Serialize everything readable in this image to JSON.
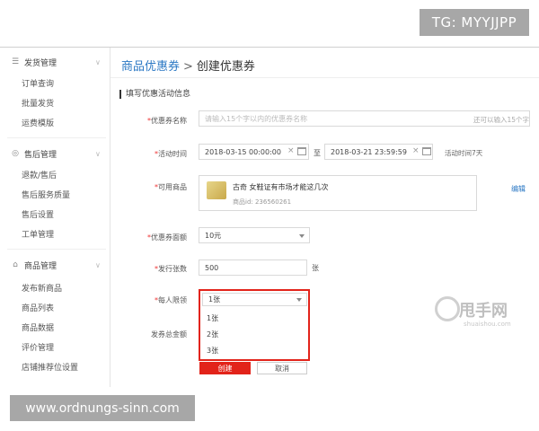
{
  "watermark_top": "TG: MYYJJPP",
  "watermark_bottom": "www.ordnungs-sinn.com",
  "site_watermark": {
    "logo": "甩手网",
    "sub": "shuaishou.com"
  },
  "sidebar": {
    "groups": [
      {
        "title": "发货管理",
        "icon": "list-icon",
        "items": [
          "订单查询",
          "批量发货",
          "运费模版"
        ]
      },
      {
        "title": "售后管理",
        "icon": "shield-icon",
        "items": [
          "退款/售后",
          "售后服务质量",
          "售后设置",
          "工单管理"
        ]
      },
      {
        "title": "商品管理",
        "icon": "bag-icon",
        "items": [
          "发布新商品",
          "商品列表",
          "商品数据",
          "评价管理",
          "店铺推荐位设置"
        ]
      }
    ]
  },
  "breadcrumb": {
    "parent": "商品优惠券",
    "separator": ">",
    "current": "创建优惠券"
  },
  "section_title": "填写优惠活动信息",
  "form": {
    "name": {
      "label": "优惠券名称",
      "placeholder": "请输入15个字以内的优惠券名称",
      "note": "还可以输入15个字"
    },
    "time": {
      "label": "活动时间",
      "start": "2018-03-15 00:00:00",
      "to": "至",
      "end": "2018-03-21 23:59:59",
      "note": "活动时间7天"
    },
    "product": {
      "label": "可用商品",
      "title": "古奇 女鞋证有市场才能这几次",
      "id_text": "商品id: 236560261",
      "edit": "编辑"
    },
    "face_value": {
      "label": "优惠券面额",
      "value": "10元"
    },
    "issue_count": {
      "label": "发行张数",
      "value": "500",
      "unit": "张"
    },
    "per_user_limit": {
      "label": "每人限领",
      "value": "1张",
      "options": [
        "1张",
        "2张",
        "3张"
      ]
    },
    "total_amount": {
      "label": "发券总金额"
    }
  },
  "buttons": {
    "create": "创建",
    "cancel": "取消"
  },
  "colors": {
    "accent_red": "#e2231a",
    "link_blue": "#2b78c4"
  }
}
